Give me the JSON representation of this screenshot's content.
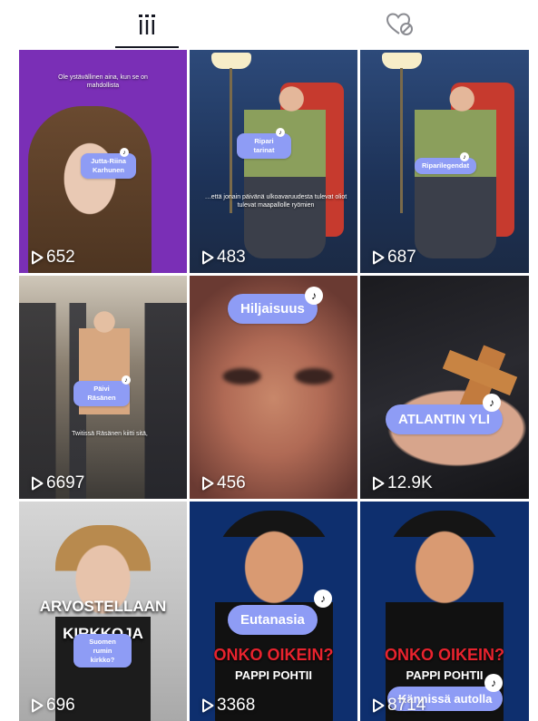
{
  "tabs": {
    "videos_icon": "grid-lines-icon",
    "liked_icon": "heart-hidden-icon"
  },
  "videos": [
    {
      "views": "652",
      "tag": "Jutta-Riina Karhunen",
      "caption": "Ole ystävällinen aina, kun se on mahdollista"
    },
    {
      "views": "483",
      "tag": "Ripari tarinat",
      "caption": "…että jonain päivänä ulkoavaruudesta tulevat oliot tulevat maapallolle ryömien"
    },
    {
      "views": "687",
      "tag": "Riparilegendat"
    },
    {
      "views": "6697",
      "tag": "Päivi Räsänen",
      "caption": "Twitissä Räsänen kiitti sitä,"
    },
    {
      "views": "456",
      "tag": "Hiljaisuus"
    },
    {
      "views": "12.9K",
      "tag": "ATLANTIN YLI"
    },
    {
      "views": "696",
      "tag": "Suomen rumin kirkko?",
      "title1": "ARVOSTELLAAN",
      "title2": "KIRKKOJA"
    },
    {
      "views": "3368",
      "tag": "Eutanasia",
      "title1": "ONKO OIKEIN?",
      "title2": "PAPPI POHTII"
    },
    {
      "views": "8714",
      "tag": "Kännissä autolla",
      "title1": "ONKO OIKEIN?",
      "title2": "PAPPI POHTII"
    }
  ],
  "colors": {
    "pill": "#8e9cf5",
    "accent_red": "#e8232e"
  }
}
